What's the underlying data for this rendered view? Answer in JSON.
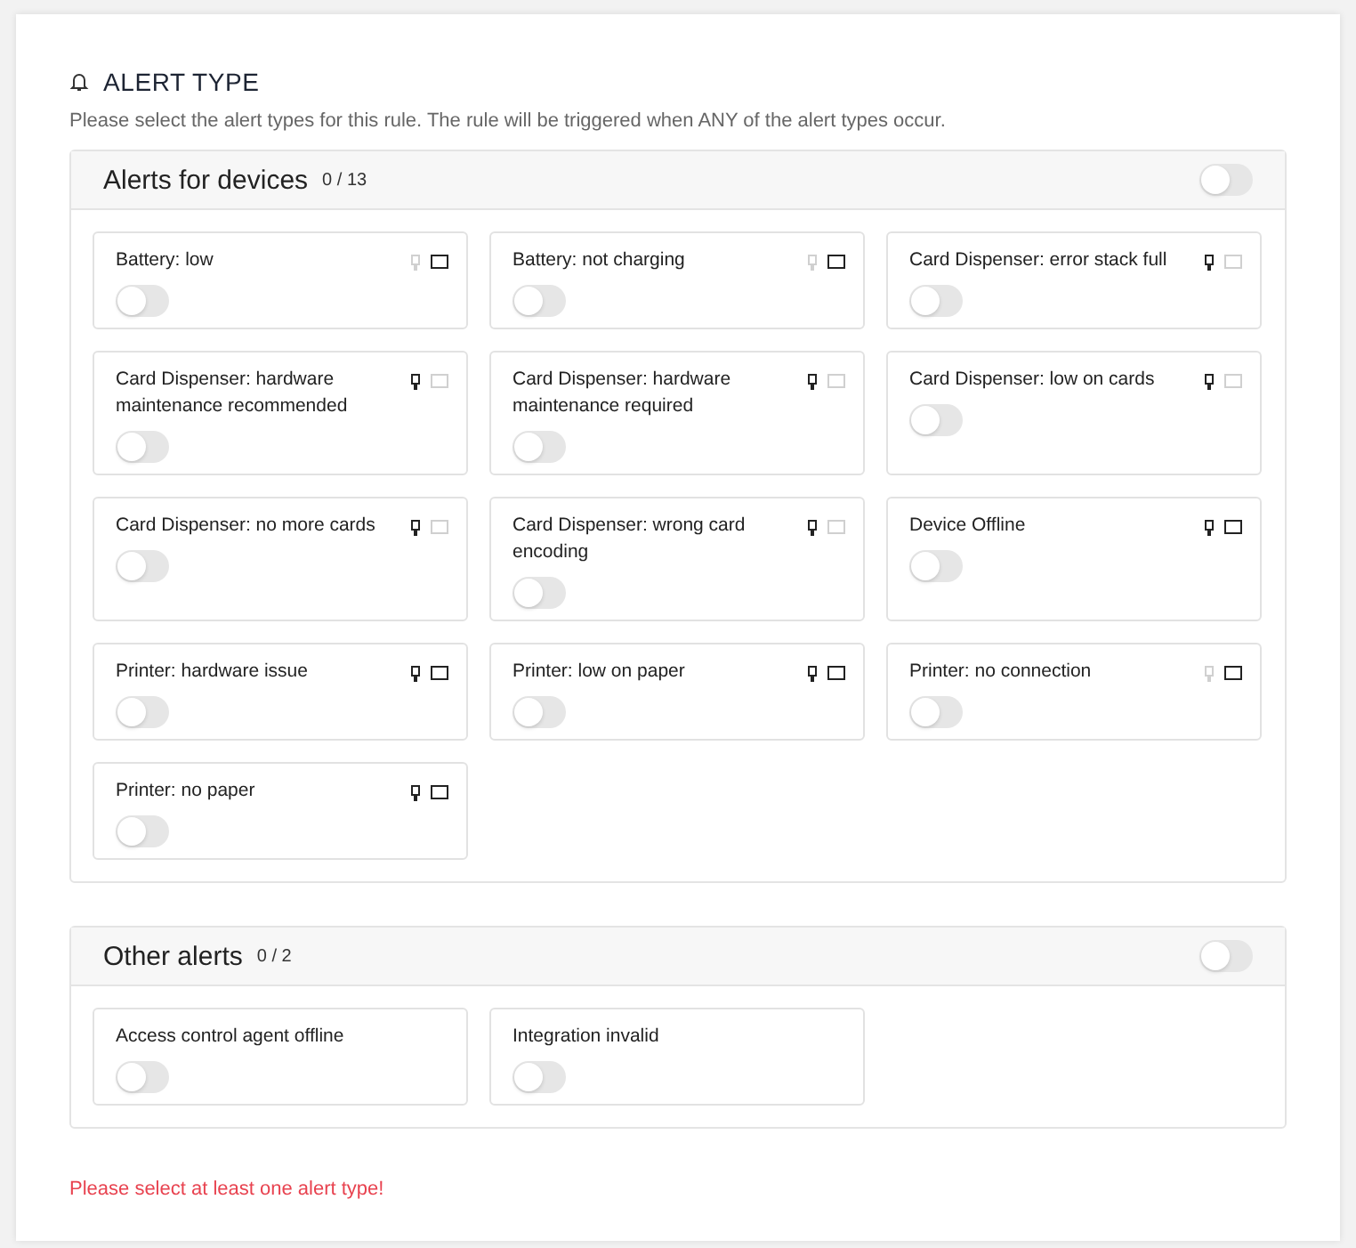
{
  "heading": "ALERT TYPE",
  "description": "Please select the alert types for this rule. The rule will be triggered when ANY of the alert types occur.",
  "groups": [
    {
      "title": "Alerts for devices",
      "count": "0 / 13",
      "on": false,
      "alerts": [
        {
          "label": "Battery: low",
          "on": false,
          "kiosk_active": false,
          "screen_active": true
        },
        {
          "label": "Battery: not charging",
          "on": false,
          "kiosk_active": false,
          "screen_active": true
        },
        {
          "label": "Card Dispenser: error stack full",
          "on": false,
          "kiosk_active": true,
          "screen_active": false
        },
        {
          "label": "Card Dispenser: hardware maintenance recommended",
          "on": false,
          "kiosk_active": true,
          "screen_active": false
        },
        {
          "label": "Card Dispenser: hardware maintenance required",
          "on": false,
          "kiosk_active": true,
          "screen_active": false
        },
        {
          "label": "Card Dispenser: low on cards",
          "on": false,
          "kiosk_active": true,
          "screen_active": false
        },
        {
          "label": "Card Dispenser: no more cards",
          "on": false,
          "kiosk_active": true,
          "screen_active": false
        },
        {
          "label": "Card Dispenser: wrong card encoding",
          "on": false,
          "kiosk_active": true,
          "screen_active": false
        },
        {
          "label": "Device Offline",
          "on": false,
          "kiosk_active": true,
          "screen_active": true
        },
        {
          "label": "Printer: hardware issue",
          "on": false,
          "kiosk_active": true,
          "screen_active": true
        },
        {
          "label": "Printer: low on paper",
          "on": false,
          "kiosk_active": true,
          "screen_active": true
        },
        {
          "label": "Printer: no connection",
          "on": false,
          "kiosk_active": false,
          "screen_active": true
        },
        {
          "label": "Printer: no paper",
          "on": false,
          "kiosk_active": true,
          "screen_active": true
        }
      ]
    },
    {
      "title": "Other alerts",
      "count": "0 / 2",
      "on": false,
      "alerts": [
        {
          "label": "Access control agent offline",
          "on": false
        },
        {
          "label": "Integration invalid",
          "on": false
        }
      ]
    }
  ],
  "error": "Please select at least one alert type!"
}
